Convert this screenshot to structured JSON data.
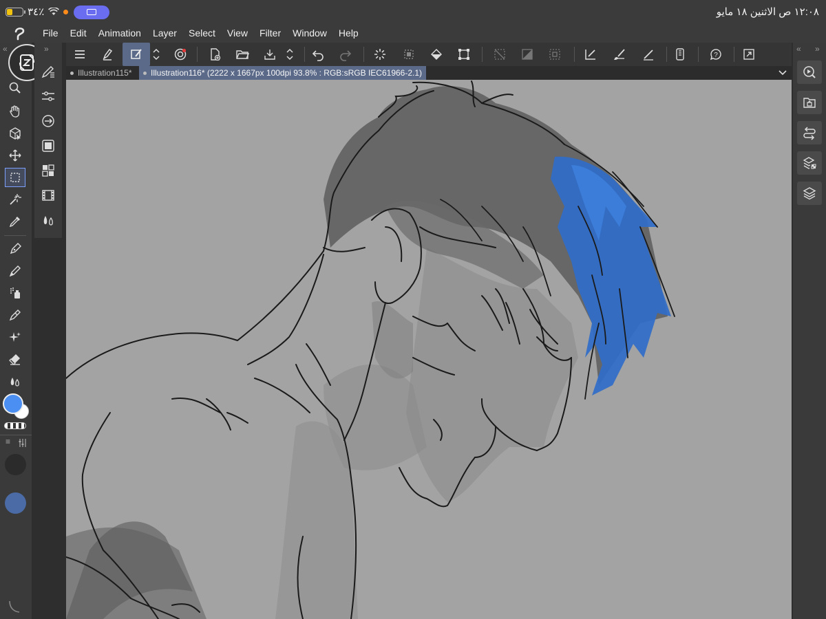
{
  "status_bar": {
    "battery_percent": "٣٤٪",
    "battery_level": 0.34,
    "clock": "١٢:٠٨ ص   الاثنين ١٨ مايو"
  },
  "menu": {
    "app_logo": "clip-studio-logo-icon",
    "items": [
      "File",
      "Edit",
      "Animation",
      "Layer",
      "Select",
      "View",
      "Filter",
      "Window",
      "Help"
    ]
  },
  "tabs": [
    {
      "label": "Illustration115*",
      "active": false
    },
    {
      "label": "Illustration116* (2222 x 1667px 100dpi 93.8% : RGB:sRGB IEC61966-2.1)",
      "active": true
    }
  ],
  "colors": {
    "main_color": "#4b8ff2",
    "sub_color": "#ffffff",
    "accent_active": "#5b6a89",
    "hair_blue": "#2f6cc8",
    "swatch_dark": "#2b2b2b",
    "swatch_blue": "#4a6ba6",
    "canvas_bg": "#a3a3a3"
  },
  "icons": {
    "left_toolbar": [
      "undo-redo-modifier-icon",
      "zoom-icon",
      "hand-icon",
      "object-icon",
      "move-icon",
      "selection-icon",
      "magic-wand-icon",
      "eyedropper-icon",
      "pen-icon",
      "pencil-icon",
      "airbrush-icon",
      "decoration-icon",
      "eraser-icon",
      "blend-icon"
    ],
    "sub_tool": [
      "sub-tool-pen-icon",
      "tool-property-icon",
      "sub-tool-detail-icon",
      "color-wheel-icon",
      "color-set-icon",
      "timeline-icon",
      "blend-drops-icon"
    ],
    "right_bar": [
      "navigator-icon",
      "material-icon",
      "history-icon",
      "layer-property-icon",
      "layer-icon"
    ]
  }
}
